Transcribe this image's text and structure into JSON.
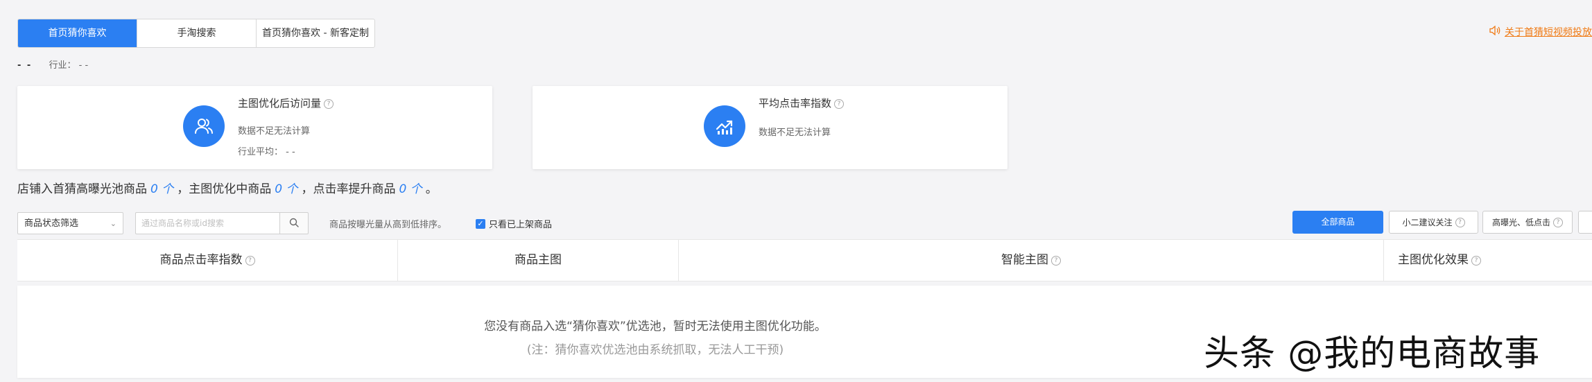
{
  "tabs": [
    {
      "label": "首页猜你喜欢",
      "active": true
    },
    {
      "label": "手淘搜索",
      "active": false
    },
    {
      "label": "首页猜你喜欢 - 新客定制",
      "active": false
    }
  ],
  "notice": {
    "text": "关于首猜短视频投放",
    "icon": "speaker-icon",
    "color": "#f07a14"
  },
  "meta": {
    "shop": "- -",
    "industry_label": "行业：",
    "industry_value": "- -"
  },
  "cards": [
    {
      "title": "主图优化后访问量",
      "icon": "users-icon",
      "line1": "数据不足无法计算",
      "line2": "行业平均：  - -"
    },
    {
      "title": "平均点击率指数",
      "icon": "trend-chart-icon",
      "line1": "数据不足无法计算"
    }
  ],
  "summary": {
    "part1": "店铺入首猜高曝光池商品",
    "n1": "0 个",
    "part2": "，主图优化中商品",
    "n2": "0 个",
    "part3": "，点击率提升商品",
    "n3": "0 个",
    "part4": "。"
  },
  "filters": {
    "status_select": "商品状态筛选",
    "search_placeholder": "通过商品名称或id搜索",
    "sort_text": "商品按曝光量从高到低排序。",
    "checkbox_label": "只看已上架商品",
    "checkbox_checked": true
  },
  "buttons": {
    "all": "全部商品",
    "recommend": "小二建议关注",
    "high_exposure": "高曝光、低点击"
  },
  "table": {
    "headers": [
      "商品点击率指数",
      "商品主图",
      "智能主图",
      "主图优化效果"
    ],
    "empty_line1": "您没有商品入选“猜你喜欢”优选池，暂时无法使用主图优化功能。",
    "empty_line2": "(注：猜你喜欢优选池由系统抓取，无法人工干预)"
  },
  "watermark": "头条 @我的电商故事",
  "colors": {
    "accent": "#2b7ff2",
    "notice": "#f07a14",
    "background": "#f4f4f6"
  }
}
